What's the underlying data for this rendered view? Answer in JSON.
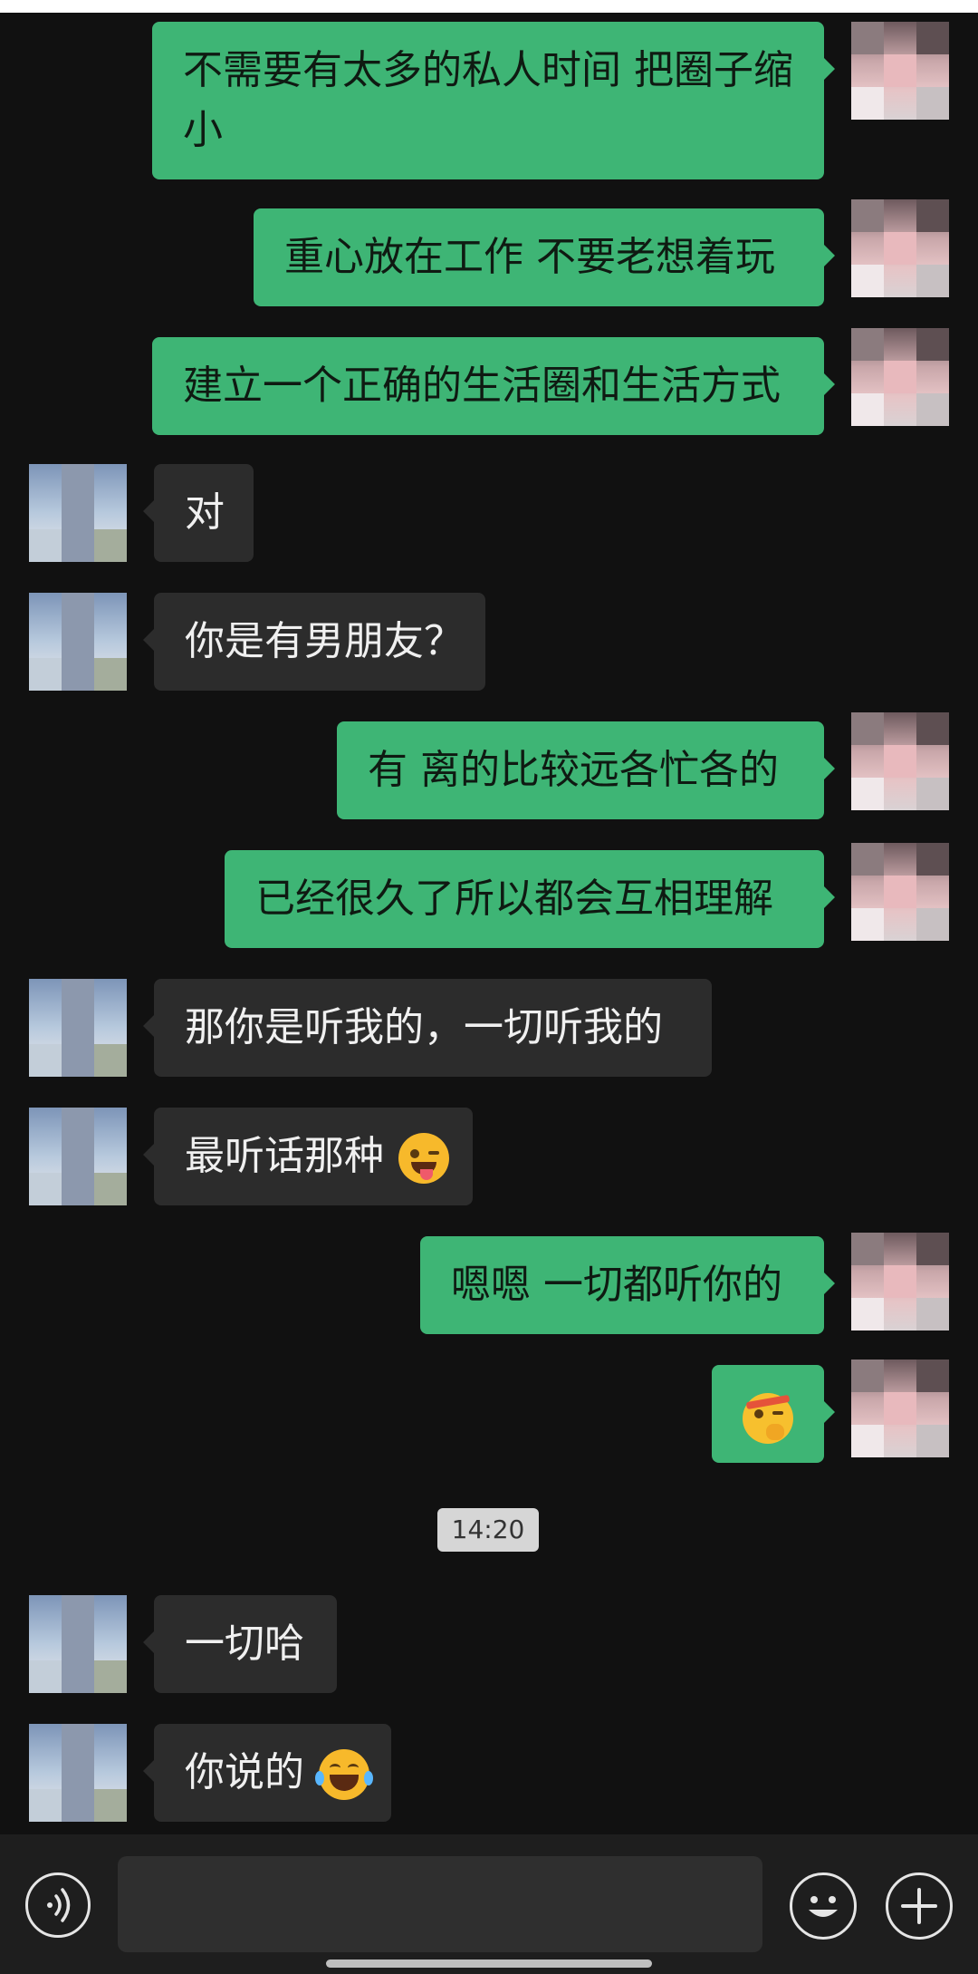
{
  "messages": [
    {
      "dir": "sent",
      "text": "不需要有太多的私人时间 把圈子缩小"
    },
    {
      "dir": "sent",
      "text": "重心放在工作 不要老想着玩"
    },
    {
      "dir": "sent",
      "text": "建立一个正确的生活圈和生活方式"
    },
    {
      "dir": "recv",
      "text": "对"
    },
    {
      "dir": "recv",
      "text": "你是有男朋友？"
    },
    {
      "dir": "sent",
      "text": "有 离的比较远各忙各的"
    },
    {
      "dir": "sent",
      "text": "已经很久了所以都会互相理解"
    },
    {
      "dir": "recv",
      "text": "那你是听我的，一切听我的"
    },
    {
      "dir": "recv",
      "text": "最听话那种",
      "emoji": "winking-tongue-emoji"
    },
    {
      "dir": "sent",
      "text": "嗯嗯 一切都听你的"
    },
    {
      "dir": "sent",
      "text": "",
      "emoji": "shushing-headband-emoji"
    },
    {
      "dir": "recv",
      "text": "一切哈"
    },
    {
      "dir": "recv",
      "text": "你说的",
      "emoji": "tears-of-joy-emoji"
    }
  ],
  "timestamp": "14:20",
  "colors": {
    "sent_bubble": "#3eb575",
    "recv_bubble": "#2c2c2c",
    "background": "#111111"
  },
  "icons": [
    "voice-icon",
    "emoji-icon",
    "add-icon"
  ]
}
